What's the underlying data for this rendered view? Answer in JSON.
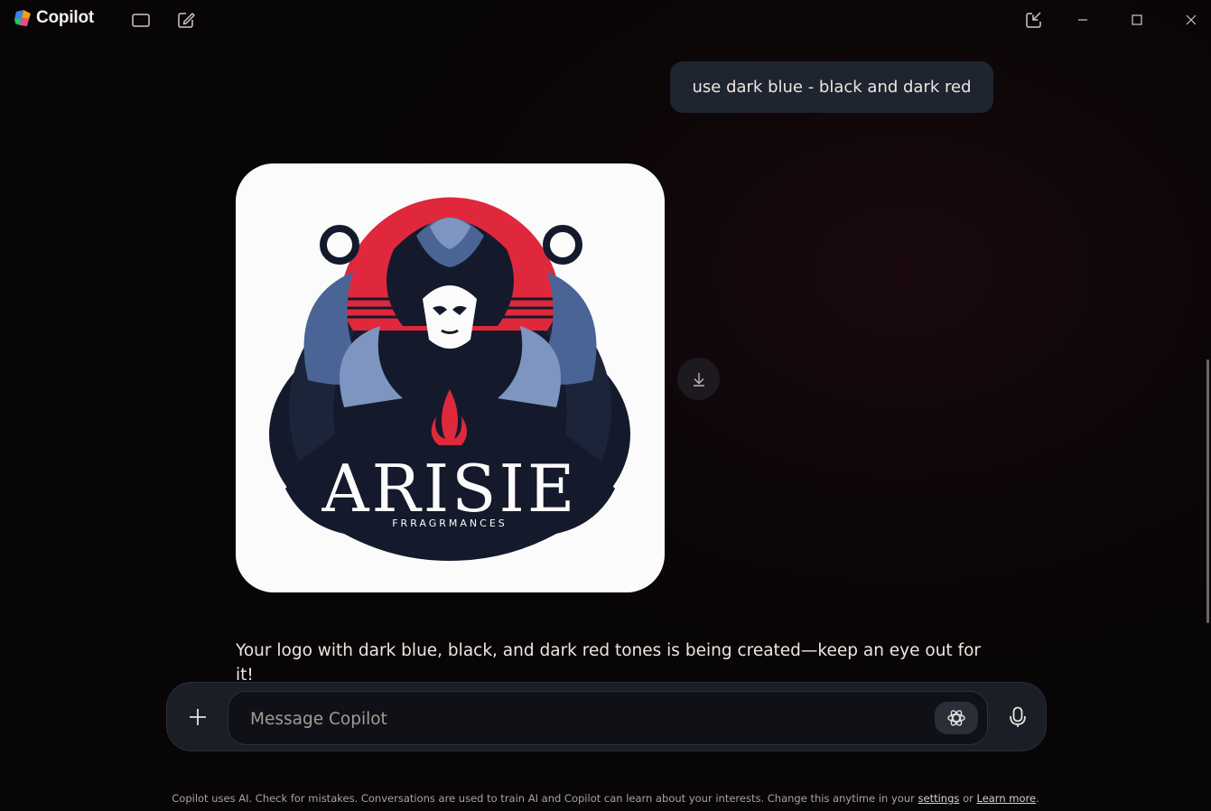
{
  "app": {
    "name": "Copilot"
  },
  "titlebar": {
    "icons": [
      "sidebar-toggle-icon",
      "new-chat-icon",
      "pop-out-icon",
      "minimize-icon",
      "maximize-icon",
      "close-icon"
    ]
  },
  "conversation": {
    "user_message": "use dark blue - black and dark red",
    "generated_image": {
      "logo_title": "ARISIE",
      "logo_subtitle": "FRRAGRMANCES",
      "colors": {
        "dark_blue": "#1b2438",
        "mid_blue": "#4a6496",
        "red": "#e0283d",
        "background": "#fbfbfc"
      }
    },
    "assistant_message": "Your logo with dark blue, black, and dark red tones is being created—keep an eye out for it!"
  },
  "composer": {
    "placeholder": "Message Copilot"
  },
  "footer": {
    "text": "Copilot uses AI. Check for mistakes. Conversations are used to train AI and Copilot can learn about your interests. Change this anytime in your",
    "settings_link": "settings",
    "or": "or",
    "learn_more_link": "Learn more",
    "period": "."
  },
  "theme": {
    "accent": "#e0283d",
    "bubble": "#1f2431",
    "composer": "#1b1e26"
  }
}
